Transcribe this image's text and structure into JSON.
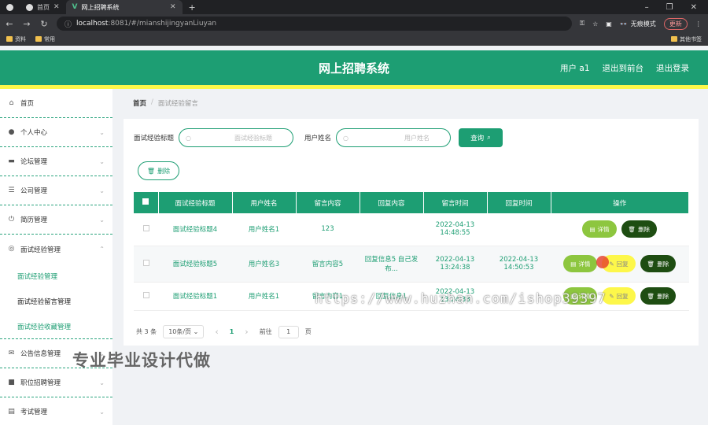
{
  "browser": {
    "tabs": [
      {
        "label": ""
      },
      {
        "label": "首页"
      },
      {
        "label": "网上招聘系统"
      }
    ],
    "url_host": "localhost",
    "url_rest": ":8081/#/mianshijingyanLiuyan",
    "incognito_label": "无痕模式",
    "update_label": "更新",
    "bookmarks": [
      "资料",
      "常用"
    ],
    "other_bookmarks": "其他书签"
  },
  "header": {
    "title": "网上招聘系统",
    "user": "用户 a1",
    "back_front": "退出到前台",
    "logout": "退出登录"
  },
  "sidebar": {
    "items": [
      {
        "label": "首页",
        "icon": "home-icon"
      },
      {
        "label": "个人中心",
        "icon": "user-icon"
      },
      {
        "label": "论坛管理",
        "icon": "forum-icon"
      },
      {
        "label": "公司管理",
        "icon": "list-icon"
      },
      {
        "label": "简历管理",
        "icon": "power-icon"
      },
      {
        "label": "面试经验管理",
        "icon": "compass-icon"
      },
      {
        "label": "公告信息管理",
        "icon": "mail-icon"
      },
      {
        "label": "职位招聘管理",
        "icon": "briefcase-icon"
      },
      {
        "label": "考试管理",
        "icon": "clipboard-icon"
      }
    ],
    "sub_items": [
      "面试经验管理",
      "面试经验留言管理",
      "面试经验收藏管理"
    ]
  },
  "breadcrumb": {
    "home": "首页",
    "sep": "/",
    "current": "面试经验留言"
  },
  "search": {
    "title_label": "面试经验标题",
    "title_placeholder": "面试经验标题",
    "user_label": "用户姓名",
    "user_placeholder": "用户姓名",
    "query_label": "查询"
  },
  "delete_label": "删除",
  "table": {
    "headers": [
      "面试经验标题",
      "用户姓名",
      "留言内容",
      "回复内容",
      "留言时间",
      "回复时间",
      "操作"
    ],
    "rows": [
      {
        "title": "面试经验标题4",
        "user": "用户姓名1",
        "content": "123",
        "reply": "",
        "time": "2022-04-13 14:48:55",
        "reply_time": ""
      },
      {
        "title": "面试经验标题5",
        "user": "用户姓名3",
        "content": "留言内容5",
        "reply": "回复信息5 自己发布...",
        "time": "2022-04-13 13:24:38",
        "reply_time": "2022-04-13 14:50:53"
      },
      {
        "title": "面试经验标题1",
        "user": "用户姓名1",
        "content": "留言内容1",
        "reply": "回复信息1",
        "time": "2022-04-13 13:24:38",
        "reply_time": ""
      }
    ],
    "op_detail": "详情",
    "op_reply": "回复",
    "op_delete": "删除"
  },
  "pager": {
    "total": "共 3 条",
    "size": "10条/页",
    "prev": "‹",
    "page": "1",
    "next": "›",
    "goto": "前往",
    "goto_value": "1",
    "page_suffix": "页"
  },
  "watermark": {
    "text": "专业毕业设计代做",
    "url": "https://www.huzhan.com/ishop39397"
  }
}
